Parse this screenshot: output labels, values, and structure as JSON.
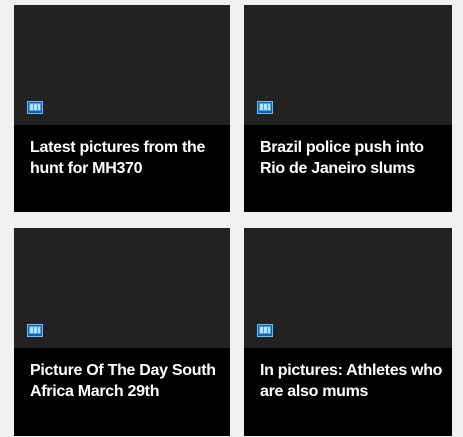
{
  "cards": [
    {
      "title": "Latest pictures from the hunt for MH370",
      "icon": "gallery-icon"
    },
    {
      "title": "Brazil police push into Rio de Janeiro slums",
      "icon": "gallery-icon"
    },
    {
      "title": "Picture Of The Day South Africa March 29th",
      "icon": "gallery-icon"
    },
    {
      "title": "In pictures: Athletes who are also mums",
      "icon": "gallery-icon"
    }
  ],
  "colors": {
    "page_bg": "#f0f0f0",
    "card_bg": "#000000",
    "thumb_bg": "#222222",
    "title_text": "#ffffff",
    "icon_blue": "#2f8fd8"
  }
}
